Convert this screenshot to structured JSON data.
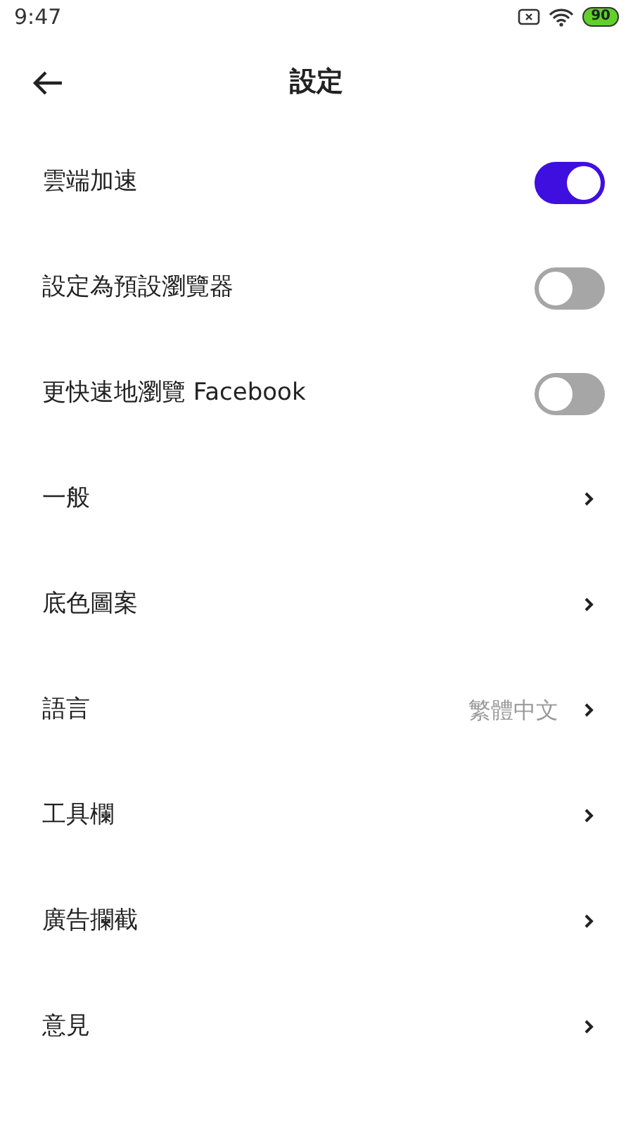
{
  "status_bar": {
    "time": "9:47",
    "battery": "90"
  },
  "header": {
    "title": "設定"
  },
  "settings": [
    {
      "kind": "toggle",
      "label": "雲端加速",
      "on": true
    },
    {
      "kind": "toggle",
      "label": "設定為預設瀏覽器",
      "on": false
    },
    {
      "kind": "toggle",
      "label": "更快速地瀏覽 Facebook",
      "on": false
    },
    {
      "kind": "link",
      "label": "一般"
    },
    {
      "kind": "link",
      "label": "底色圖案"
    },
    {
      "kind": "link",
      "label": "語言",
      "value": "繁體中文"
    },
    {
      "kind": "link",
      "label": "工具欄"
    },
    {
      "kind": "link",
      "label": "廣告攔截"
    },
    {
      "kind": "link",
      "label": "意見"
    }
  ]
}
